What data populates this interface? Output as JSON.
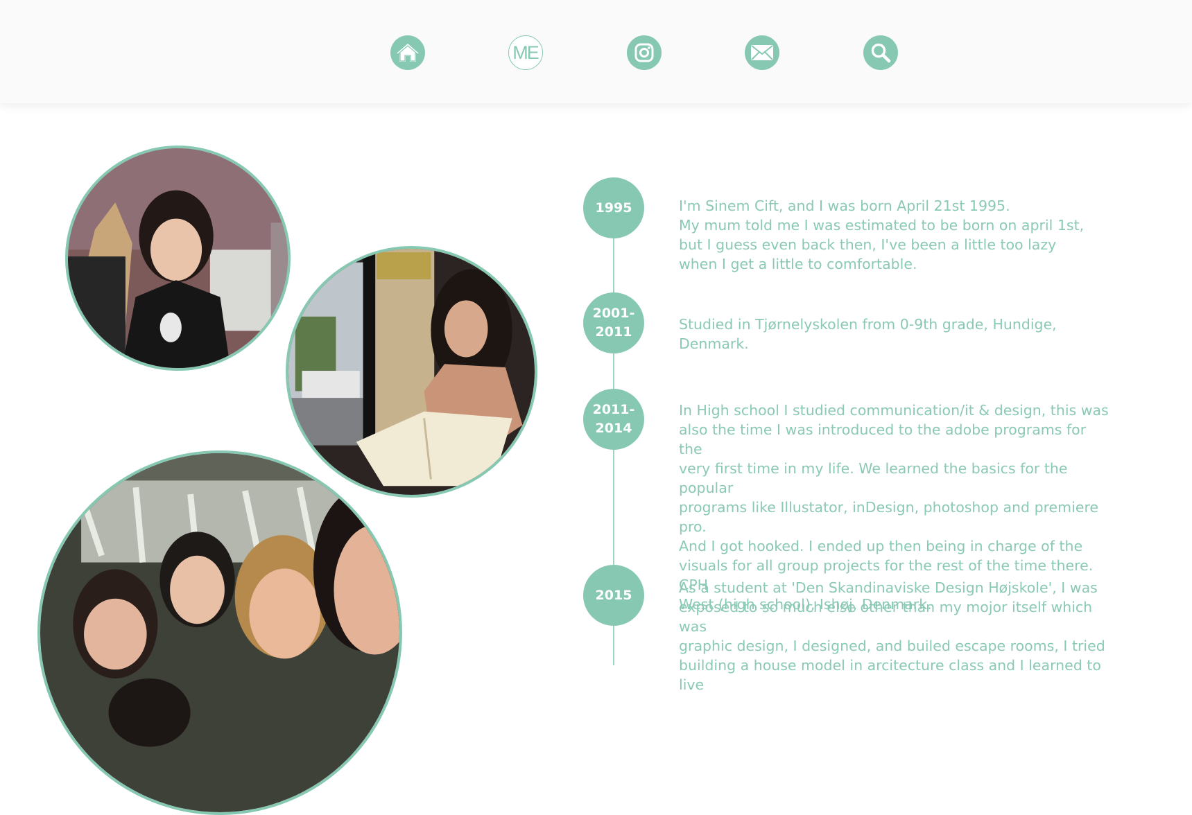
{
  "nav": {
    "items": [
      {
        "icon": "home-icon"
      },
      {
        "icon": "me-icon",
        "label": "ME"
      },
      {
        "icon": "instagram-icon"
      },
      {
        "icon": "mail-icon"
      },
      {
        "icon": "search-icon"
      }
    ]
  },
  "colors": {
    "accent": "#86c8b1",
    "text": "#8ac9b3",
    "navbar": "#fafafa"
  },
  "timeline": [
    {
      "year": "1995",
      "text": "I'm Sinem Cift, and I was born April 21st 1995.\nMy mum told me I was estimated to be born on april 1st,\nbut I guess even back then, I've been a little too lazy\nwhen I get a little to comfortable."
    },
    {
      "year": "2001-\n2011",
      "text": "Studied in Tjørnelyskolen from 0-9th grade, Hundige, Denmark."
    },
    {
      "year": "2011-\n2014",
      "text": "In High school I studied communication/it & design, this was\nalso the time I was introduced to the adobe programs for the\nvery first time in my life. We learned the basics for the popular\nprograms like Illustator, inDesign, photoshop and premiere pro.\nAnd I got hooked. I ended up then being in charge of the\nvisuals for all group projects for the rest of the time there. CPH\nWest (high school), Ishøj, Denmark."
    },
    {
      "year": "2015",
      "text": "As a student at 'Den Skandinaviske Design Højskole',  I was\nexposed to so much else other than my mojor itself which was\ngraphic design, I designed, and builed escape rooms, I tried\nbuilding a house model in arcitecture class and I learned to live"
    }
  ]
}
